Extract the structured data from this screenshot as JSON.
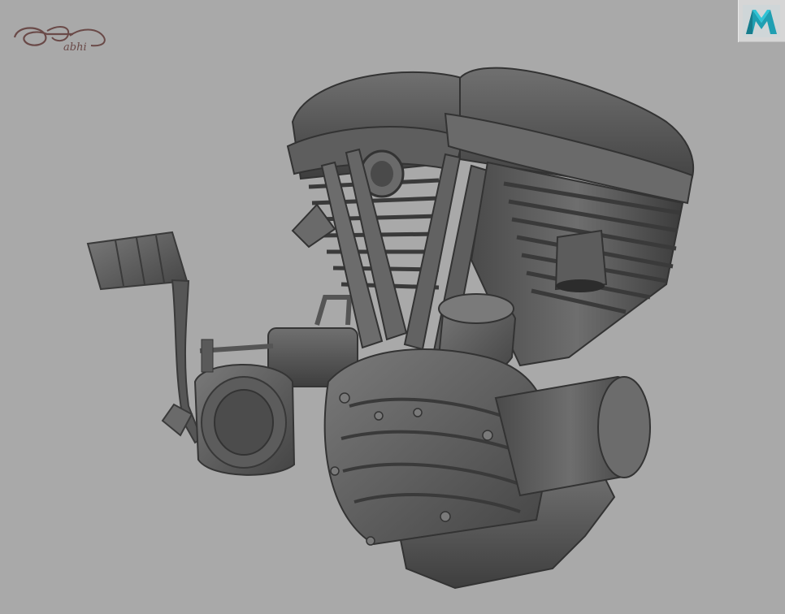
{
  "viewport": {
    "background_color": "#a9a9a9",
    "model_color": "#5a5a5a",
    "subject": "motorcycle-v-twin-engine-3d-model"
  },
  "watermark": {
    "signature_text": "abhi",
    "icon": "signature-logo"
  },
  "app_badge": {
    "icon": "maya-logo-icon",
    "accent_color": "#1ea5b8"
  }
}
